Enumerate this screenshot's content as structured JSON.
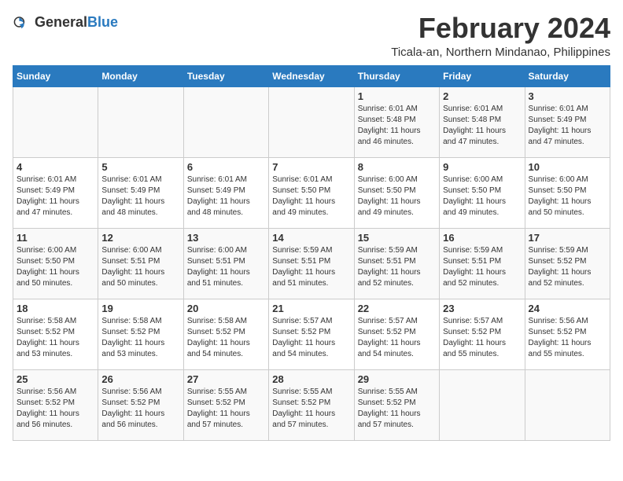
{
  "header": {
    "logo_general": "General",
    "logo_blue": "Blue",
    "main_title": "February 2024",
    "subtitle": "Ticala-an, Northern Mindanao, Philippines"
  },
  "columns": [
    "Sunday",
    "Monday",
    "Tuesday",
    "Wednesday",
    "Thursday",
    "Friday",
    "Saturday"
  ],
  "weeks": [
    [
      {
        "day": "",
        "info": ""
      },
      {
        "day": "",
        "info": ""
      },
      {
        "day": "",
        "info": ""
      },
      {
        "day": "",
        "info": ""
      },
      {
        "day": "1",
        "info": "Sunrise: 6:01 AM\nSunset: 5:48 PM\nDaylight: 11 hours\nand 46 minutes."
      },
      {
        "day": "2",
        "info": "Sunrise: 6:01 AM\nSunset: 5:48 PM\nDaylight: 11 hours\nand 47 minutes."
      },
      {
        "day": "3",
        "info": "Sunrise: 6:01 AM\nSunset: 5:49 PM\nDaylight: 11 hours\nand 47 minutes."
      }
    ],
    [
      {
        "day": "4",
        "info": "Sunrise: 6:01 AM\nSunset: 5:49 PM\nDaylight: 11 hours\nand 47 minutes."
      },
      {
        "day": "5",
        "info": "Sunrise: 6:01 AM\nSunset: 5:49 PM\nDaylight: 11 hours\nand 48 minutes."
      },
      {
        "day": "6",
        "info": "Sunrise: 6:01 AM\nSunset: 5:49 PM\nDaylight: 11 hours\nand 48 minutes."
      },
      {
        "day": "7",
        "info": "Sunrise: 6:01 AM\nSunset: 5:50 PM\nDaylight: 11 hours\nand 49 minutes."
      },
      {
        "day": "8",
        "info": "Sunrise: 6:00 AM\nSunset: 5:50 PM\nDaylight: 11 hours\nand 49 minutes."
      },
      {
        "day": "9",
        "info": "Sunrise: 6:00 AM\nSunset: 5:50 PM\nDaylight: 11 hours\nand 49 minutes."
      },
      {
        "day": "10",
        "info": "Sunrise: 6:00 AM\nSunset: 5:50 PM\nDaylight: 11 hours\nand 50 minutes."
      }
    ],
    [
      {
        "day": "11",
        "info": "Sunrise: 6:00 AM\nSunset: 5:50 PM\nDaylight: 11 hours\nand 50 minutes."
      },
      {
        "day": "12",
        "info": "Sunrise: 6:00 AM\nSunset: 5:51 PM\nDaylight: 11 hours\nand 50 minutes."
      },
      {
        "day": "13",
        "info": "Sunrise: 6:00 AM\nSunset: 5:51 PM\nDaylight: 11 hours\nand 51 minutes."
      },
      {
        "day": "14",
        "info": "Sunrise: 5:59 AM\nSunset: 5:51 PM\nDaylight: 11 hours\nand 51 minutes."
      },
      {
        "day": "15",
        "info": "Sunrise: 5:59 AM\nSunset: 5:51 PM\nDaylight: 11 hours\nand 52 minutes."
      },
      {
        "day": "16",
        "info": "Sunrise: 5:59 AM\nSunset: 5:51 PM\nDaylight: 11 hours\nand 52 minutes."
      },
      {
        "day": "17",
        "info": "Sunrise: 5:59 AM\nSunset: 5:52 PM\nDaylight: 11 hours\nand 52 minutes."
      }
    ],
    [
      {
        "day": "18",
        "info": "Sunrise: 5:58 AM\nSunset: 5:52 PM\nDaylight: 11 hours\nand 53 minutes."
      },
      {
        "day": "19",
        "info": "Sunrise: 5:58 AM\nSunset: 5:52 PM\nDaylight: 11 hours\nand 53 minutes."
      },
      {
        "day": "20",
        "info": "Sunrise: 5:58 AM\nSunset: 5:52 PM\nDaylight: 11 hours\nand 54 minutes."
      },
      {
        "day": "21",
        "info": "Sunrise: 5:57 AM\nSunset: 5:52 PM\nDaylight: 11 hours\nand 54 minutes."
      },
      {
        "day": "22",
        "info": "Sunrise: 5:57 AM\nSunset: 5:52 PM\nDaylight: 11 hours\nand 54 minutes."
      },
      {
        "day": "23",
        "info": "Sunrise: 5:57 AM\nSunset: 5:52 PM\nDaylight: 11 hours\nand 55 minutes."
      },
      {
        "day": "24",
        "info": "Sunrise: 5:56 AM\nSunset: 5:52 PM\nDaylight: 11 hours\nand 55 minutes."
      }
    ],
    [
      {
        "day": "25",
        "info": "Sunrise: 5:56 AM\nSunset: 5:52 PM\nDaylight: 11 hours\nand 56 minutes."
      },
      {
        "day": "26",
        "info": "Sunrise: 5:56 AM\nSunset: 5:52 PM\nDaylight: 11 hours\nand 56 minutes."
      },
      {
        "day": "27",
        "info": "Sunrise: 5:55 AM\nSunset: 5:52 PM\nDaylight: 11 hours\nand 57 minutes."
      },
      {
        "day": "28",
        "info": "Sunrise: 5:55 AM\nSunset: 5:52 PM\nDaylight: 11 hours\nand 57 minutes."
      },
      {
        "day": "29",
        "info": "Sunrise: 5:55 AM\nSunset: 5:52 PM\nDaylight: 11 hours\nand 57 minutes."
      },
      {
        "day": "",
        "info": ""
      },
      {
        "day": "",
        "info": ""
      }
    ]
  ]
}
